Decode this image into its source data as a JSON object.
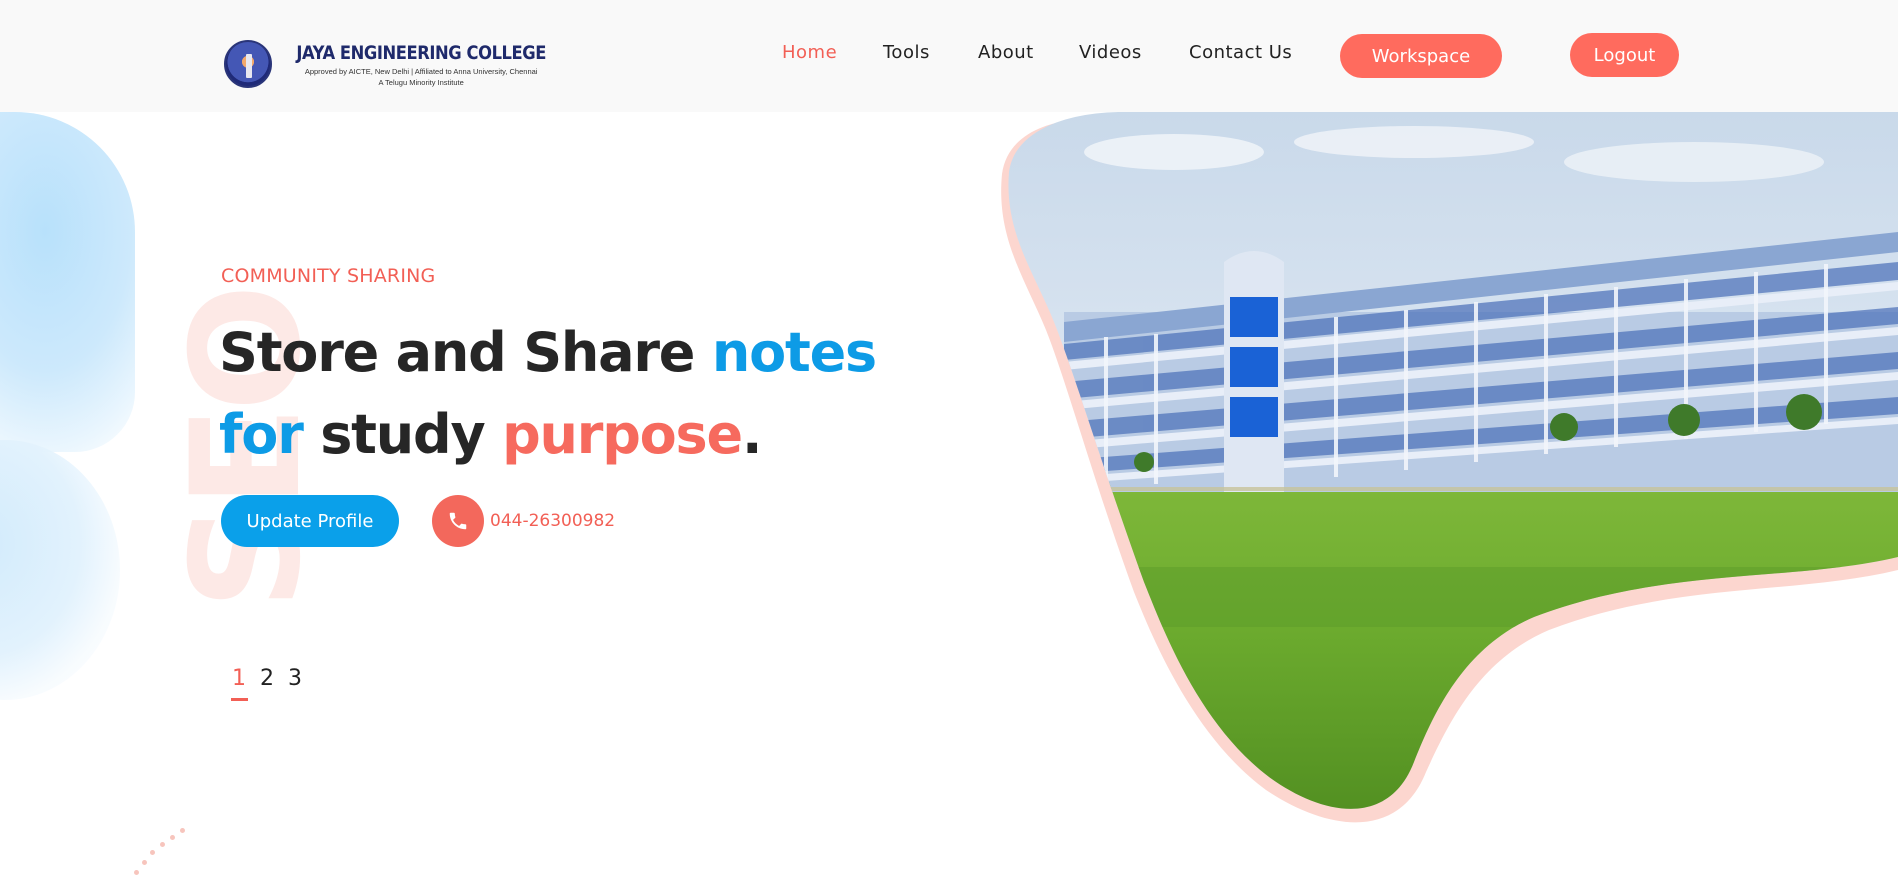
{
  "brand": {
    "name": "JAYA ENGINEERING COLLEGE",
    "tagline": "Approved by AICTE, New Delhi | Affiliated to Anna University, Chennai",
    "tagline2": "A Telugu Minority Institute"
  },
  "nav": {
    "items": [
      {
        "label": "Home",
        "active": true
      },
      {
        "label": "Tools",
        "active": false
      },
      {
        "label": "About",
        "active": false
      },
      {
        "label": "Videos",
        "active": false
      },
      {
        "label": "Contact Us",
        "active": false
      }
    ],
    "workspace_label": "Workspace",
    "logout_label": "Logout"
  },
  "hero": {
    "eyebrow": "COMMUNITY SHARING",
    "headline": {
      "part1": "Store and Share ",
      "part2": "notes",
      "part3": "for",
      "part4": " study ",
      "part5": "purpose",
      "part6": "."
    },
    "update_profile_label": "Update Profile",
    "phone": "044-26300982",
    "background_text": "SEO"
  },
  "pager": {
    "pages": [
      "1",
      "2",
      "3"
    ],
    "active_index": 0
  },
  "colors": {
    "coral": "#f25f55",
    "blue": "#0aa0ea",
    "dark_text": "#262626",
    "header_bg": "#f9f9f9"
  },
  "icons": {
    "phone": "phone-icon"
  }
}
